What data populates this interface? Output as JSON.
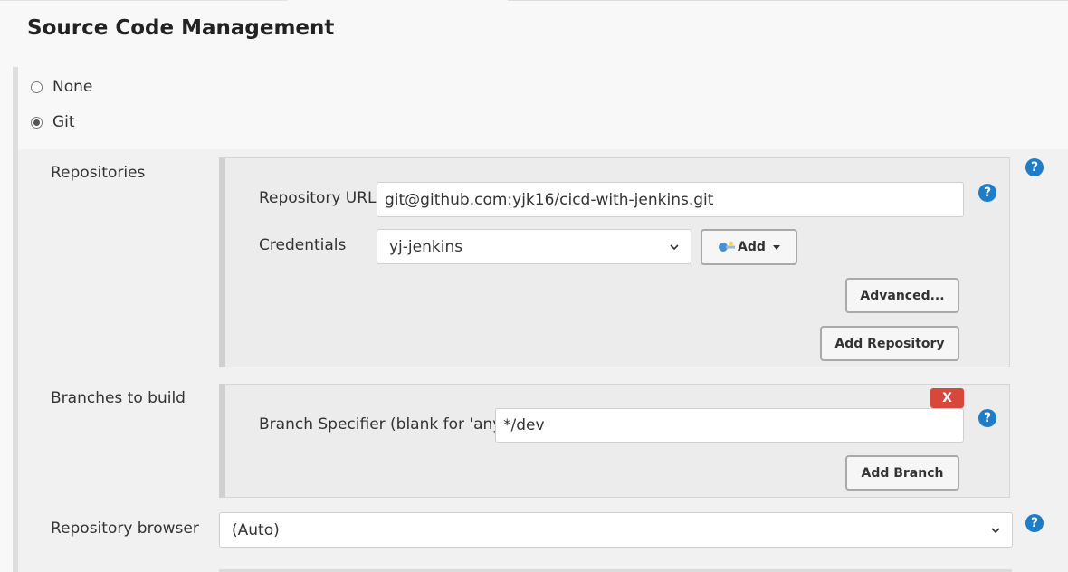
{
  "section": {
    "title": "Source Code Management"
  },
  "scm_options": [
    {
      "label": "None",
      "selected": false
    },
    {
      "label": "Git",
      "selected": true
    }
  ],
  "repositories": {
    "label": "Repositories",
    "url_label": "Repository URL",
    "url_value": "git@github.com:yjk16/cicd-with-jenkins.git",
    "credentials_label": "Credentials",
    "credentials_value": "yj-jenkins",
    "add_label": "Add",
    "advanced_label": "Advanced...",
    "add_repository_label": "Add Repository"
  },
  "branches": {
    "label": "Branches to build",
    "specifier_label": "Branch Specifier (blank for 'any')",
    "specifier_value": "*/dev",
    "delete_label": "X",
    "add_branch_label": "Add Branch"
  },
  "repo_browser": {
    "label": "Repository browser",
    "value": "(Auto)"
  },
  "help_glyph": "?",
  "colors": {
    "help": "#1e7dc8",
    "delete": "#d9463c"
  }
}
